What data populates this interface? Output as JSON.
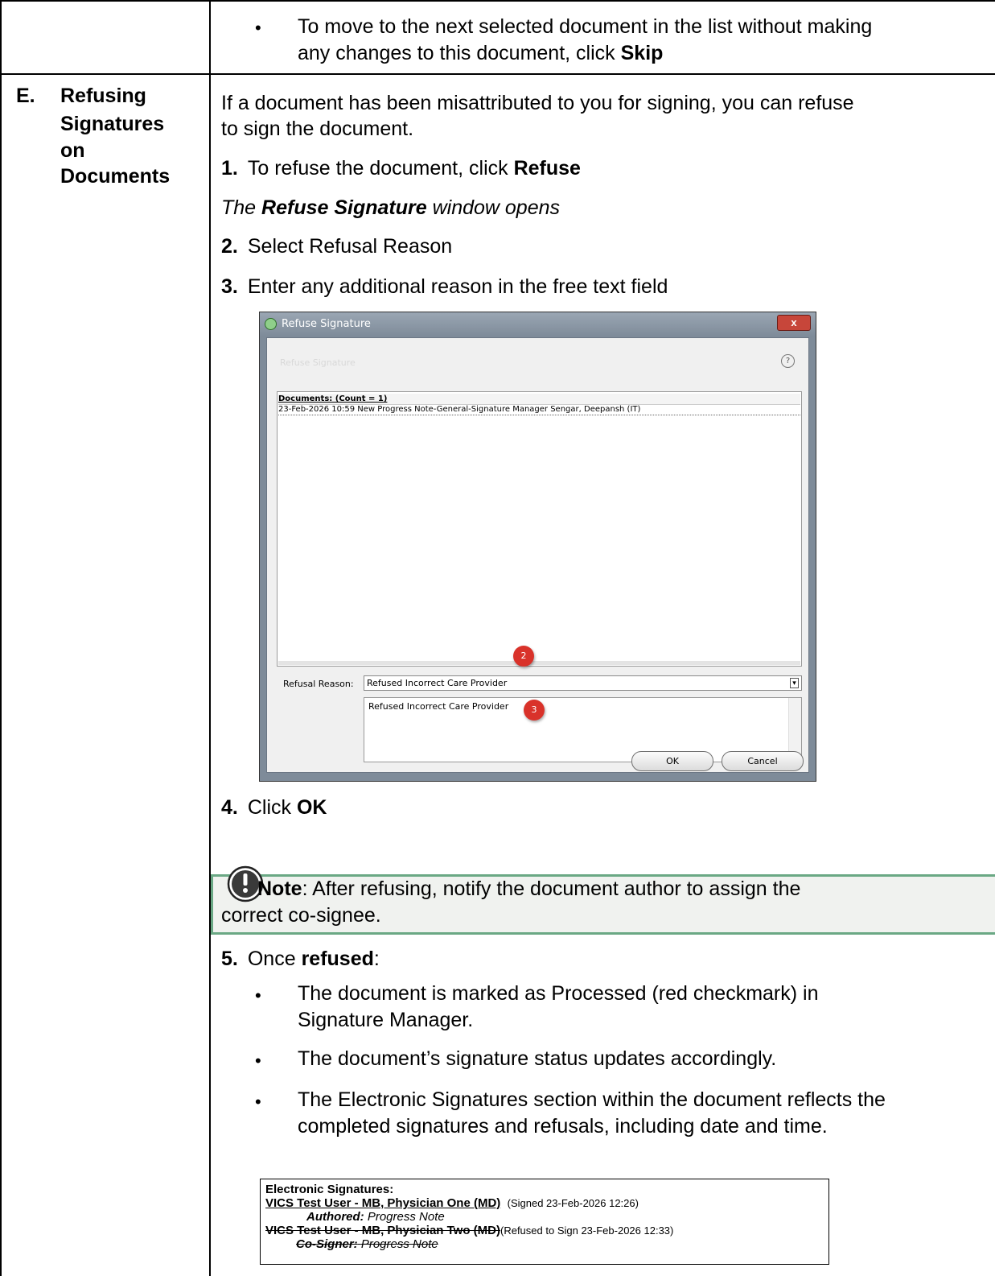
{
  "row_top": {
    "bullet": "To move to the next selected document in the list without making",
    "bullet_line2_pre": "any changes to this document, click ",
    "bullet_line2_bold": "Skip"
  },
  "section": {
    "letter": "E.",
    "title_l1": "Refusing",
    "title_l2": "Signatures",
    "title_l3": "on",
    "title_l4": "Documents"
  },
  "intro_l1": "If a document has been misattributed to you for signing, you can refuse",
  "intro_l2": "to sign the document.",
  "steps": {
    "s1_num": "1.",
    "s1_pre": "To refuse the document, click ",
    "s1_bold": "Refuse",
    "s1_result_pre": "The ",
    "s1_result_bold": "Refuse Signature",
    "s1_result_post": " window opens",
    "s2_num": "2.",
    "s2": "Select Refusal Reason",
    "s3_num": "3.",
    "s3": "Enter any additional reason in the free text field",
    "s4_num": "4.",
    "s4_pre": "Click ",
    "s4_bold": "OK",
    "s5_num": "5.",
    "s5_pre": "Once ",
    "s5_bold": "refused",
    "s5_post": ":"
  },
  "dialog": {
    "title": "Refuse Signature",
    "header": "Refuse Signature",
    "help": "?",
    "list_header": "Documents: (Count = 1)",
    "list_item": "23-Feb-2026 10:59 New Progress Note-General-Signature Manager Sengar, Deepansh (IT)",
    "reason_label": "Refusal Reason:",
    "reason_value": "Refused Incorrect Care Provider",
    "free_text": "Refused Incorrect Care Provider",
    "ok": "OK",
    "cancel": "Cancel",
    "close": "x",
    "badge2": "2",
    "badge3": "3"
  },
  "note": {
    "bold": "Note",
    "l1": ": After refusing, notify the document author to assign the",
    "l2": "correct co-signee."
  },
  "outcomes": {
    "b1_l1": "The document is marked as Processed (red checkmark) in",
    "b1_l2": "Signature Manager.",
    "b2": "The document’s signature status updates accordingly.",
    "b3_l1": "The Electronic Signatures section within the document reflects the",
    "b3_l2": "completed signatures and refusals, including date and time."
  },
  "esig": {
    "title": "Electronic Signatures:",
    "signer1": "VICS Test User - MB, Physician One (MD)",
    "signer1_status": "(Signed 23-Feb-2026 12:26)",
    "role1_label": "Authored:",
    "role1_doc": "Progress Note",
    "signer2": "VICS Test User - MB, Physician Two (MD)",
    "signer2_status": "(Refused to Sign 23-Feb-2026 12:33)",
    "role2_label": "Co-Signer:",
    "role2_doc": "Progress Note"
  },
  "colors": {
    "note_border": "#6aa884",
    "badge": "#d9322a"
  }
}
